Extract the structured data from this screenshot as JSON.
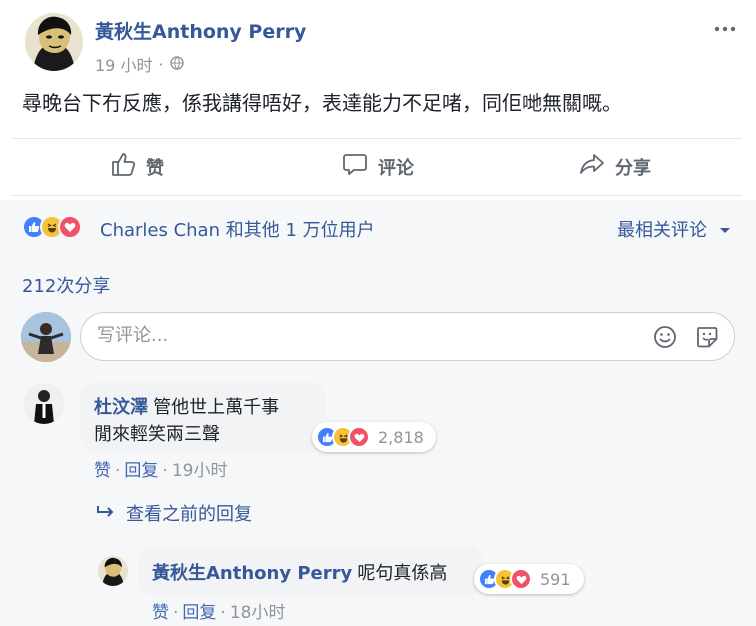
{
  "post": {
    "author": "黃秋生Anthony Perry",
    "time": "19 小时",
    "audience_sep": "·",
    "text": "尋晚台下冇反應，係我講得唔好，表達能力不足啫，同佢哋無關嘅。"
  },
  "actions": {
    "like": "赞",
    "comment": "评论",
    "share": "分享"
  },
  "reactions": {
    "summary": "Charles Chan 和其他 1 万位用户",
    "sort": "最相关评论"
  },
  "shares": "212次分享",
  "composer": {
    "placeholder": "写评论..."
  },
  "comments": [
    {
      "author": "杜汶澤",
      "line1": "管他世上萬千事",
      "line2": "閒來輕笑兩三聲",
      "reaction_count": "2,818",
      "like_label": "赞",
      "reply_label": "回复",
      "time": "19小时"
    }
  ],
  "view_previous": "查看之前的回复",
  "reply": {
    "author": "黃秋生Anthony Perry",
    "text": "呢句真係高",
    "reaction_count": "591",
    "like_label": "赞",
    "reply_label": "回复",
    "time": "18小时"
  },
  "colors": {
    "link": "#365899",
    "like_blue": "#4080ff",
    "haha_yellow": "#f7c23b",
    "love_red": "#f25268",
    "muted": "#90949c"
  },
  "icons": [
    "thumbs-up-icon",
    "comment-bubble-icon",
    "share-arrow-icon",
    "globe-icon",
    "more-dots-icon",
    "emoji-icon",
    "sticker-icon",
    "reply-arrow-icon"
  ]
}
